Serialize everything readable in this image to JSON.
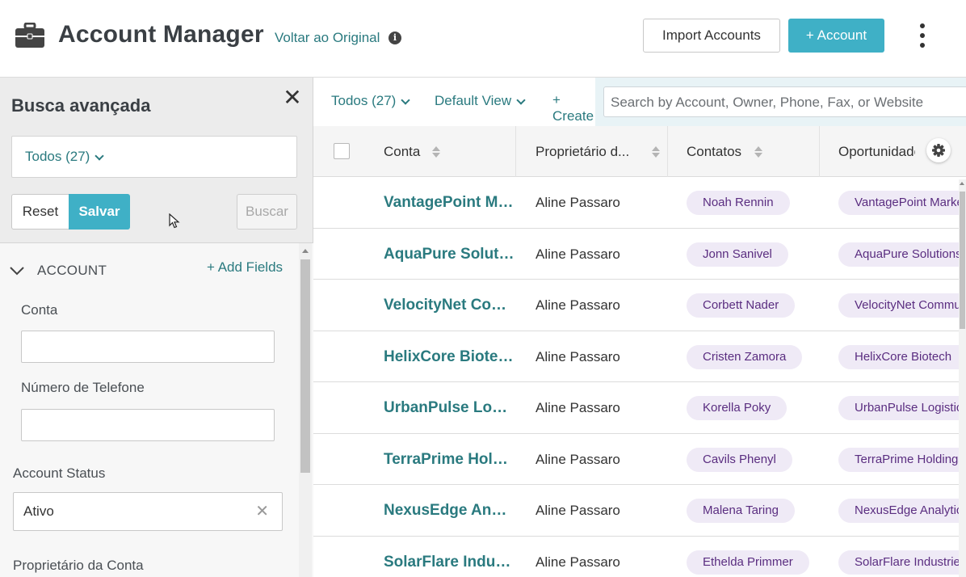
{
  "header": {
    "title": "Account Manager",
    "back_link": "Voltar ao Original",
    "import_label": "Import Accounts",
    "add_label": "+ Account"
  },
  "sidebar": {
    "title": "Busca avançada",
    "filter_select": "Todos (27)",
    "reset_label": "Reset",
    "save_label": "Salvar",
    "search_label": "Buscar",
    "section_title": "ACCOUNT",
    "add_fields_label": "+ Add Fields",
    "fields": [
      {
        "label": "Conta",
        "value": ""
      },
      {
        "label": "Número de Telefone",
        "value": ""
      },
      {
        "label": "Account Status",
        "value": "Ativo"
      },
      {
        "label": "Proprietário da Conta",
        "value": ""
      }
    ]
  },
  "toolbar": {
    "filter": "Todos (27)",
    "view": "Default View",
    "create": "+ Create",
    "search_placeholder": "Search by Account, Owner, Phone, Fax, or Website"
  },
  "table": {
    "columns": [
      "Conta",
      "Proprietário d...",
      "Contatos",
      "Oportunidades"
    ],
    "rows": [
      {
        "account": "VantagePoint Marketing",
        "owner": "Aline Passaro",
        "contact": "Noah Rennin",
        "opportunity": "VantagePoint Marketing"
      },
      {
        "account": "AquaPure Solutions",
        "owner": "Aline Passaro",
        "contact": "Jonn Sanivel",
        "opportunity": "AquaPure Solutions"
      },
      {
        "account": "VelocityNet Communications",
        "owner": "Aline Passaro",
        "contact": "Corbett Nader",
        "opportunity": "VelocityNet Communications"
      },
      {
        "account": "HelixCore Biotech",
        "owner": "Aline Passaro",
        "contact": "Cristen Zamora",
        "opportunity": "HelixCore Biotech"
      },
      {
        "account": "UrbanPulse Logistics",
        "owner": "Aline Passaro",
        "contact": "Korella Poky",
        "opportunity": "UrbanPulse Logistics"
      },
      {
        "account": "TerraPrime Holdings",
        "owner": "Aline Passaro",
        "contact": "Cavils Phenyl",
        "opportunity": "TerraPrime Holdings"
      },
      {
        "account": "NexusEdge Analytics",
        "owner": "Aline Passaro",
        "contact": "Malena Taring",
        "opportunity": "NexusEdge Analytics"
      },
      {
        "account": "SolarFlare Industries",
        "owner": "Aline Passaro",
        "contact": "Ethelda Primmer",
        "opportunity": "SolarFlare Industries"
      }
    ]
  },
  "colors": {
    "accent": "#3fb0c6",
    "link": "#2a7a7f",
    "pill_bg": "#efeaf6",
    "pill_text": "#5a2d80"
  },
  "icons": [
    "briefcase-icon",
    "info-icon",
    "kebab-menu-icon",
    "close-icon",
    "chevron-down-icon",
    "sort-icon",
    "gear-icon",
    "clear-icon"
  ]
}
